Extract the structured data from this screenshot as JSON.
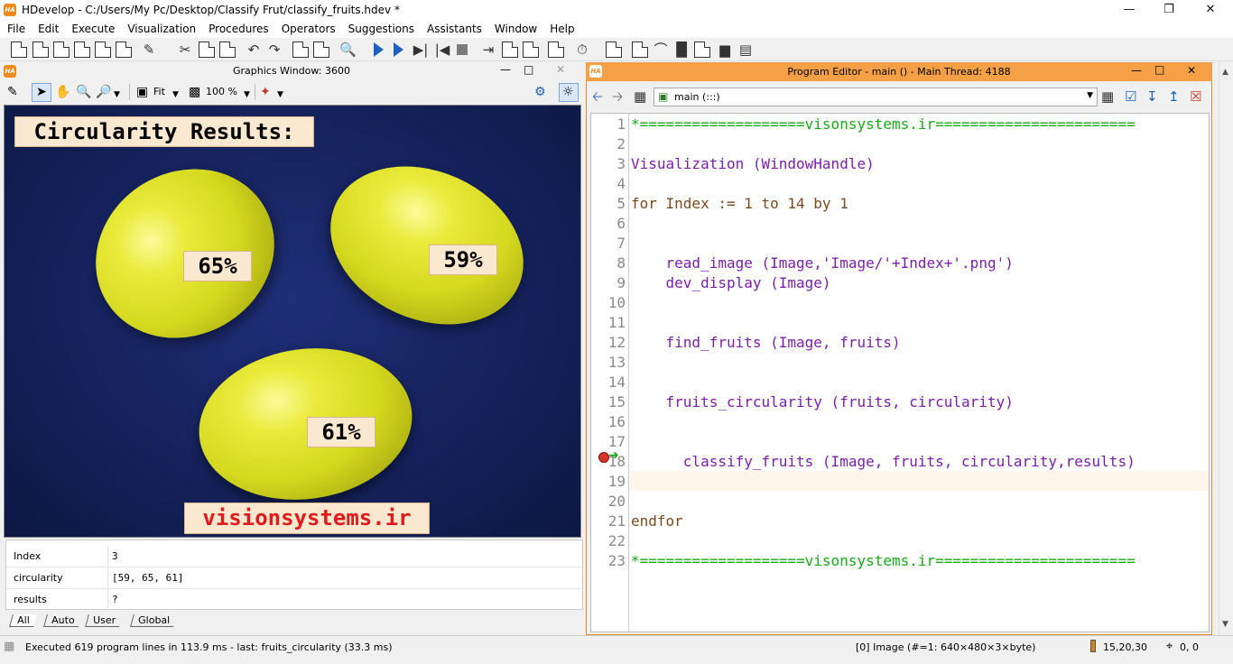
{
  "window": {
    "title": "HDevelop - C:/Users/My Pc/Desktop/Classify Frut/classify_fruits.hdev *",
    "logo": "HA"
  },
  "menu": [
    "File",
    "Edit",
    "Execute",
    "Visualization",
    "Procedures",
    "Operators",
    "Suggestions",
    "Assistants",
    "Window",
    "Help"
  ],
  "graphics_window": {
    "title": "Graphics Window: 3600",
    "zoom_fit": "Fit",
    "zoom_percent": "100 %",
    "header_label": "Circularity Results:",
    "labels": [
      "65%",
      "59%",
      "61%"
    ],
    "watermark": "visionsystems.ir"
  },
  "variables": {
    "rows": [
      {
        "name": "Index",
        "value": "3"
      },
      {
        "name": "circularity",
        "value": "[59, 65, 61]"
      },
      {
        "name": "results",
        "value": "?"
      }
    ],
    "tabs": [
      "All",
      "Auto",
      "User",
      "Global"
    ]
  },
  "program_editor": {
    "title": "Program Editor - main () - Main Thread: 4188",
    "procedure": "main (:::)",
    "current_line": 19,
    "breakpoint_line": 18,
    "lines": [
      {
        "n": "1",
        "text": "*===================visonsystems.ir=======================",
        "kind": "comment"
      },
      {
        "n": "2",
        "text": "",
        "kind": "plain"
      },
      {
        "n": "3",
        "text": "Visualization (WindowHandle)",
        "kind": "proc"
      },
      {
        "n": "4",
        "text": "",
        "kind": "plain"
      },
      {
        "n": "5",
        "text": "for Index := 1 to 14 by 1",
        "kind": "kw"
      },
      {
        "n": "6",
        "text": "",
        "kind": "plain"
      },
      {
        "n": "7",
        "text": "",
        "kind": "plain"
      },
      {
        "n": "8",
        "text": "    read_image (Image,'Image/'+Index+'.png')",
        "kind": "proc"
      },
      {
        "n": "9",
        "text": "    dev_display (Image)",
        "kind": "proc"
      },
      {
        "n": "10",
        "text": "",
        "kind": "plain"
      },
      {
        "n": "11",
        "text": "",
        "kind": "plain"
      },
      {
        "n": "12",
        "text": "    find_fruits (Image, fruits)",
        "kind": "proc"
      },
      {
        "n": "13",
        "text": "",
        "kind": "plain"
      },
      {
        "n": "14",
        "text": "",
        "kind": "plain"
      },
      {
        "n": "15",
        "text": "    fruits_circularity (fruits, circularity)",
        "kind": "proc"
      },
      {
        "n": "16",
        "text": "",
        "kind": "plain"
      },
      {
        "n": "17",
        "text": "",
        "kind": "plain"
      },
      {
        "n": "18",
        "text": "      classify_fruits (Image, fruits, circularity,results)",
        "kind": "proc"
      },
      {
        "n": "19",
        "text": "",
        "kind": "plain"
      },
      {
        "n": "20",
        "text": "",
        "kind": "plain"
      },
      {
        "n": "21",
        "text": "endfor",
        "kind": "kw"
      },
      {
        "n": "22",
        "text": "",
        "kind": "plain"
      },
      {
        "n": "23",
        "text": "*===================visonsystems.ir=======================",
        "kind": "comment"
      }
    ]
  },
  "status": {
    "message": "Executed 619 program lines in 113.9 ms - last: fruits_circularity (33.3 ms)",
    "image_info": "[0] Image (#=1: 640×480×3×byte)",
    "pixel_value": "15,20,30",
    "coords": "0, 0"
  }
}
